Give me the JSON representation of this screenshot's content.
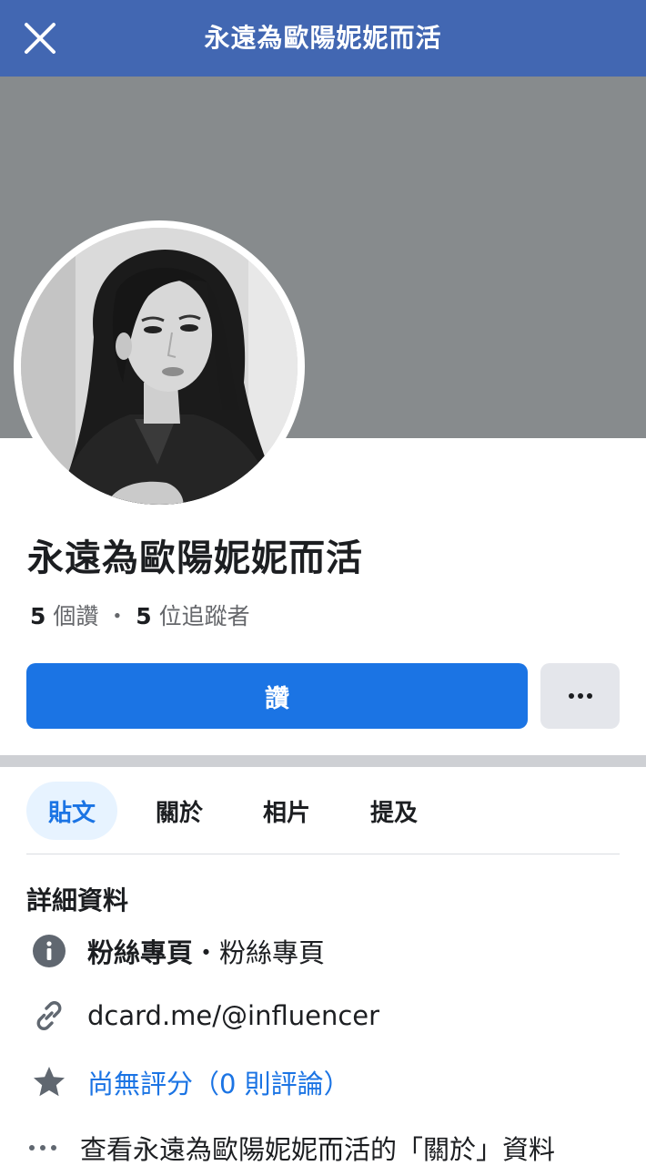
{
  "header": {
    "title": "永遠為歐陽妮妮而活",
    "close_icon": "close-icon"
  },
  "profile": {
    "name": "永遠為歐陽妮妮而活",
    "likes_count": "5",
    "likes_label": "個讚",
    "separator": "・",
    "followers_count": "5",
    "followers_label": "位追蹤者"
  },
  "actions": {
    "like_label": "讚",
    "more_icon": "more-horizontal-icon"
  },
  "tabs": [
    {
      "label": "貼文",
      "active": true
    },
    {
      "label": "關於",
      "active": false
    },
    {
      "label": "相片",
      "active": false
    },
    {
      "label": "提及",
      "active": false
    }
  ],
  "details": {
    "title": "詳細資料",
    "category_bold": "粉絲專頁",
    "category_sep": "・",
    "category_rest": "粉絲專頁",
    "website": "dcard.me/@influencer",
    "rating": "尚無評分（0 則評論）",
    "see_about": "查看永遠為歐陽妮妮而活的「關於」資料"
  },
  "colors": {
    "topbar": "#4267b2",
    "cover": "#878b8d",
    "primary": "#1b74e4"
  }
}
